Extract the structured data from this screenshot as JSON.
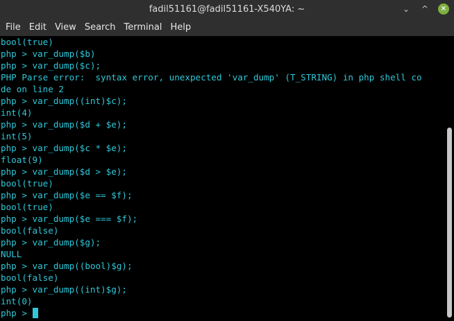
{
  "window": {
    "title": "fadil51161@fadil51161-X540YA: ~",
    "minimize_glyph": "⌄",
    "maximize_glyph": "^",
    "close_glyph": "×"
  },
  "menu": {
    "items": [
      "File",
      "Edit",
      "View",
      "Search",
      "Terminal",
      "Help"
    ]
  },
  "terminal": {
    "lines": [
      "bool(true)",
      "php > var_dump($b)",
      "php > var_dump($c);",
      "PHP Parse error:  syntax error, unexpected 'var_dump' (T_STRING) in php shell co",
      "de on line 2",
      "php > var_dump((int)$c);",
      "int(4)",
      "php > var_dump($d + $e);",
      "int(5)",
      "php > var_dump($c * $e);",
      "float(9)",
      "php > var_dump($d > $e);",
      "bool(true)",
      "php > var_dump($e == $f);",
      "bool(true)",
      "php > var_dump($e === $f);",
      "bool(false)",
      "php > var_dump($g);",
      "NULL",
      "php > var_dump((bool)$g);",
      "bool(false)",
      "php > var_dump((int)$g);",
      "int(0)"
    ],
    "prompt": "php > ",
    "text_color": "#2ec8d8",
    "background_color": "#000000"
  },
  "colors": {
    "titlebar_bg": "#2f2f2f",
    "close_button": "#7fb03f"
  }
}
